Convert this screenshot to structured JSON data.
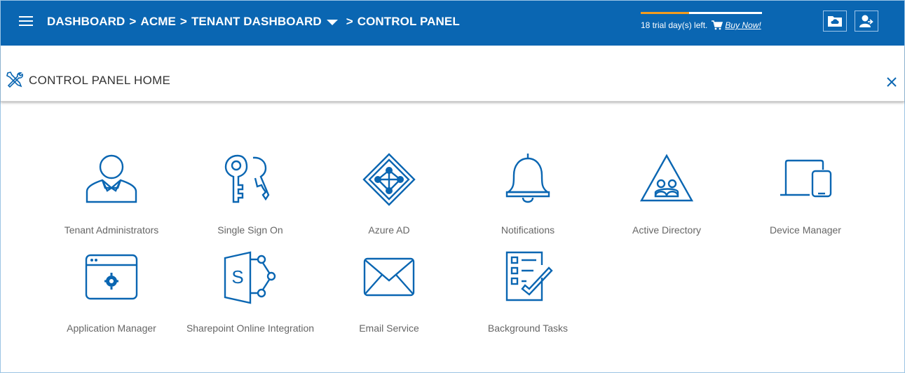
{
  "header": {
    "breadcrumbs": [
      "DASHBOARD",
      "ACME",
      "TENANT DASHBOARD",
      "CONTROL PANEL"
    ],
    "separator": ">",
    "trial": {
      "progress": 0.4,
      "text": "18 trial day(s) left.",
      "buy_label": "Buy Now!"
    }
  },
  "subheader": {
    "title": "CONTROL PANEL HOME"
  },
  "tiles": [
    {
      "label": "Tenant Administrators",
      "icon": "user-admin-icon"
    },
    {
      "label": "Single Sign On",
      "icon": "keys-icon"
    },
    {
      "label": "Azure AD",
      "icon": "azure-ad-icon"
    },
    {
      "label": "Notifications",
      "icon": "bell-icon"
    },
    {
      "label": "Active Directory",
      "icon": "active-directory-icon"
    },
    {
      "label": "Device Manager",
      "icon": "devices-icon"
    },
    {
      "label": "Application Manager",
      "icon": "app-window-gear-icon"
    },
    {
      "label": "Sharepoint Online Integration",
      "icon": "sharepoint-icon"
    },
    {
      "label": "Email Service",
      "icon": "envelope-icon"
    },
    {
      "label": "Background Tasks",
      "icon": "checklist-icon"
    }
  ],
  "colors": {
    "brand": "#0a66b2",
    "accent": "#f39c1f",
    "icon": "#0a66b2"
  }
}
